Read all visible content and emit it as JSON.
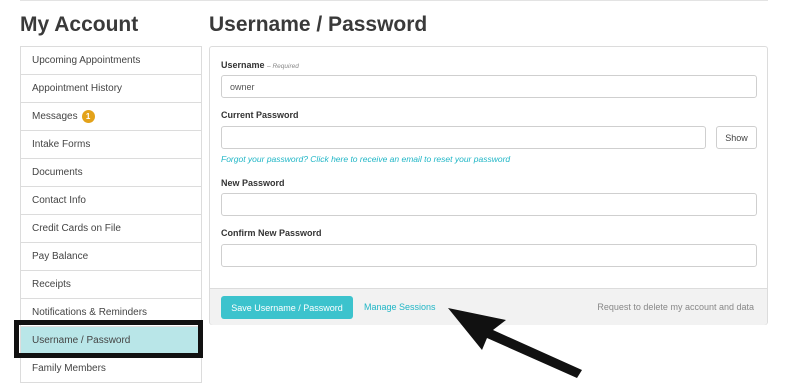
{
  "sidebar": {
    "title": "My Account",
    "items": [
      {
        "label": "Upcoming Appointments"
      },
      {
        "label": "Appointment History"
      },
      {
        "label": "Messages",
        "badge": "1"
      },
      {
        "label": "Intake Forms"
      },
      {
        "label": "Documents"
      },
      {
        "label": "Contact Info"
      },
      {
        "label": "Credit Cards on File"
      },
      {
        "label": "Pay Balance"
      },
      {
        "label": "Receipts"
      },
      {
        "label": "Notifications & Reminders"
      },
      {
        "label": "Username / Password",
        "active": true
      },
      {
        "label": "Family Members"
      }
    ]
  },
  "main": {
    "title": "Username / Password",
    "username": {
      "label": "Username",
      "required_note": "– Required",
      "value": "owner"
    },
    "current_password": {
      "label": "Current Password",
      "value": "",
      "show_label": "Show"
    },
    "forgot_link": "Forgot your password? Click here to receive an email to reset your password",
    "new_password": {
      "label": "New Password",
      "value": ""
    },
    "confirm_password": {
      "label": "Confirm New Password",
      "value": ""
    },
    "footer": {
      "save_label": "Save Username / Password",
      "manage_label": "Manage Sessions",
      "delete_label": "Request to delete my account and data"
    }
  },
  "colors": {
    "accent": "#3cc3cd",
    "link": "#20b6c6",
    "active_item": "#b9e6e8",
    "badge": "#e3a21a"
  }
}
